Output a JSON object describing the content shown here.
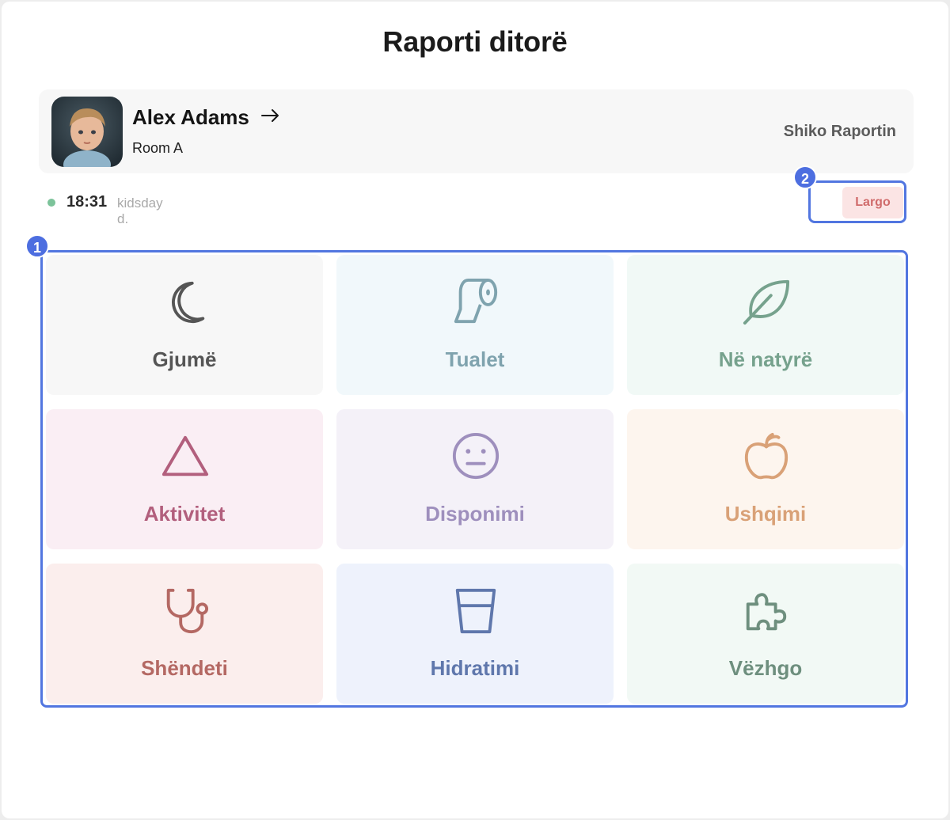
{
  "header": {
    "title": "Raporti ditorë"
  },
  "child": {
    "name": "Alex Adams",
    "room": "Room A",
    "report_link": "Shiko Raportin"
  },
  "status": {
    "time": "18:31",
    "label": "kidsday d.",
    "color": "#7cc39a"
  },
  "actions": {
    "largo_label": "Largo"
  },
  "markers": {
    "grid": "1",
    "largo": "2"
  },
  "accent": "#5276e0",
  "tiles": [
    {
      "label": "Gjumë",
      "icon": "moon-icon",
      "color": "#555555",
      "bg": "#f7f7f7"
    },
    {
      "label": "Tualet",
      "icon": "toilet-paper-icon",
      "color": "#7fa3ae",
      "bg": "#f1f8fb"
    },
    {
      "label": "Në natyrë",
      "icon": "leaf-icon",
      "color": "#76a28d",
      "bg": "#f1f9f6"
    },
    {
      "label": "Aktivitet",
      "icon": "triangle-icon",
      "color": "#b25f7d",
      "bg": "#faeef4"
    },
    {
      "label": "Disponimi",
      "icon": "neutral-face-icon",
      "color": "#9e8fbd",
      "bg": "#f4f1f8"
    },
    {
      "label": "Ushqimi",
      "icon": "apple-icon",
      "color": "#d9a177",
      "bg": "#fdf5ee"
    },
    {
      "label": "Shëndeti",
      "icon": "stethoscope-icon",
      "color": "#b46863",
      "bg": "#fbeeed"
    },
    {
      "label": "Hidratimi",
      "icon": "glass-icon",
      "color": "#5f77ac",
      "bg": "#eef2fc"
    },
    {
      "label": "Vëzhgo",
      "icon": "puzzle-icon",
      "color": "#6e8f7e",
      "bg": "#f2f9f5"
    }
  ]
}
